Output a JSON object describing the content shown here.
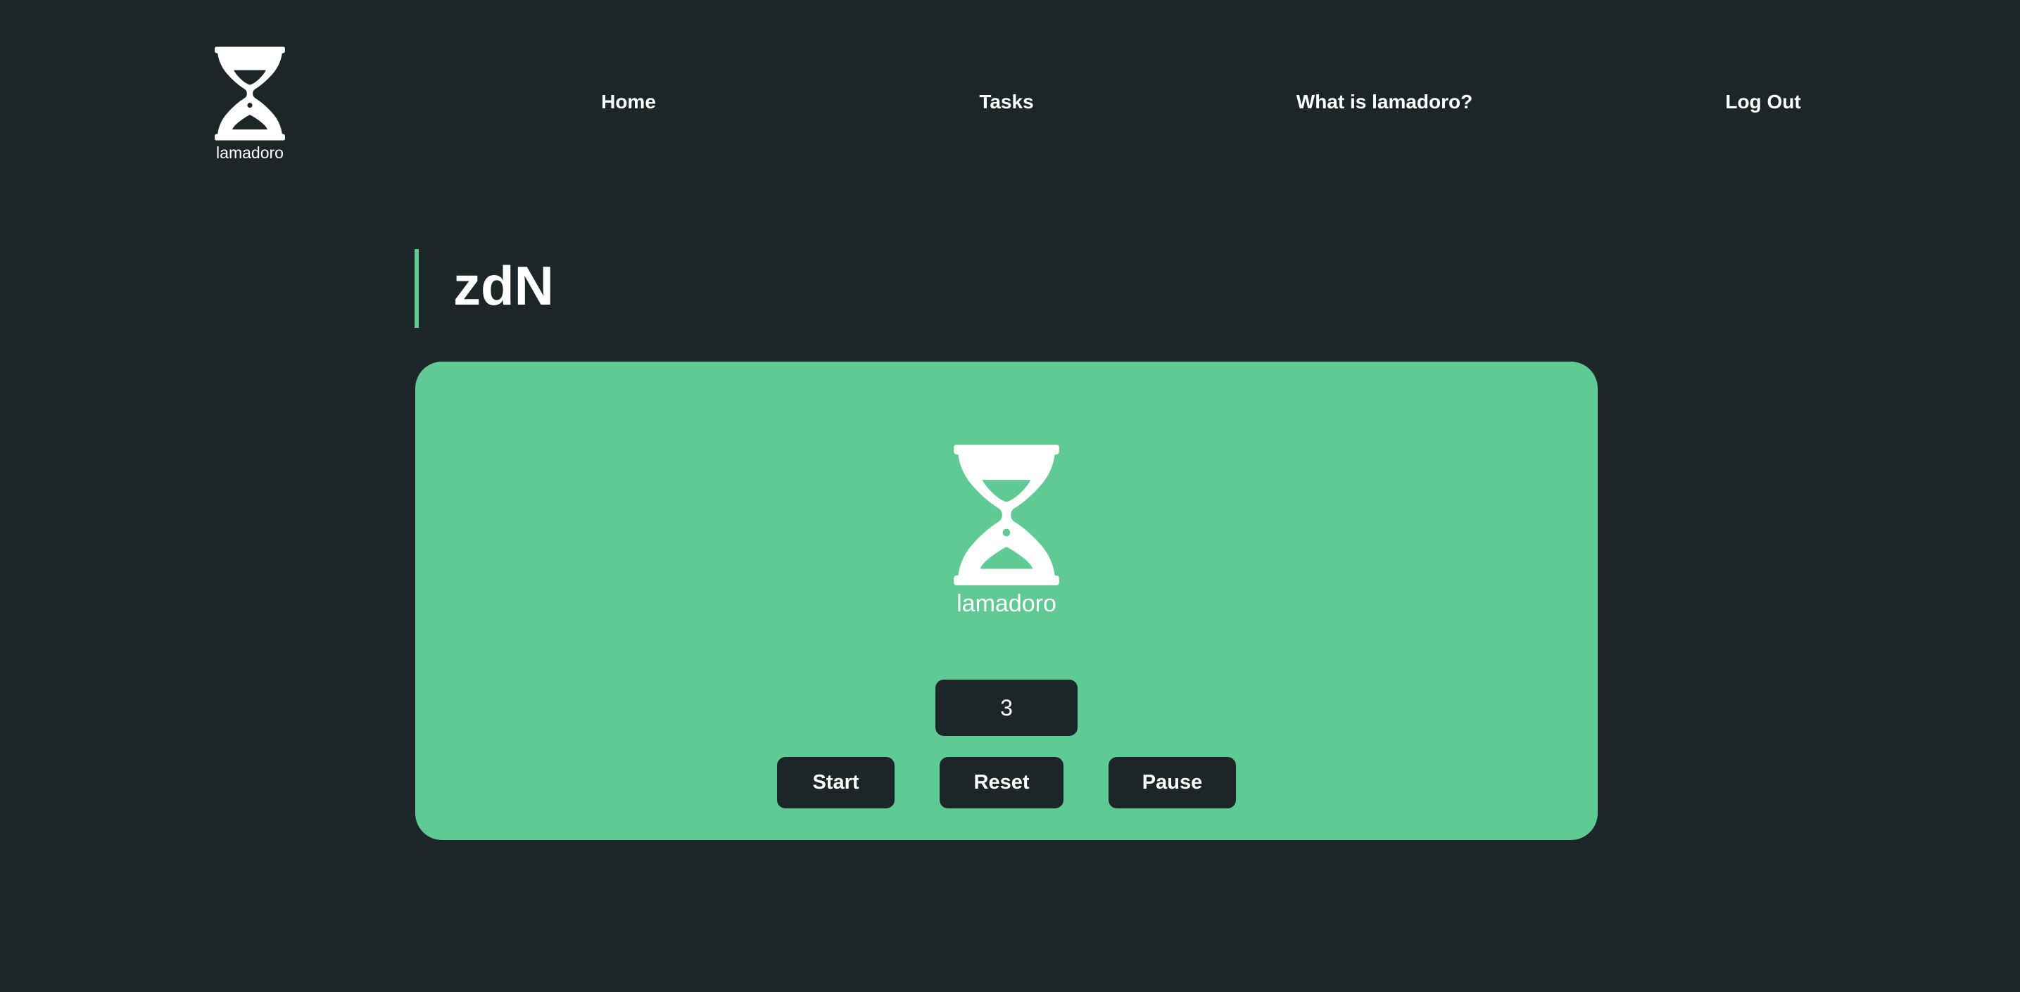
{
  "header": {
    "brand_name": "lamadoro",
    "brand_icon": "hourglass-icon",
    "nav": {
      "home": "Home",
      "tasks": "Tasks",
      "about": "What is lamadoro?",
      "logout": "Log Out"
    }
  },
  "task": {
    "title": "zdN"
  },
  "timer_card": {
    "brand_name": "lamadoro",
    "brand_icon": "hourglass-icon",
    "counter_value": "3",
    "start_label": "Start",
    "reset_label": "Reset",
    "pause_label": "Pause"
  },
  "colors": {
    "background": "#1c2528",
    "accent": "#5fca93",
    "text": "#ffffff"
  }
}
